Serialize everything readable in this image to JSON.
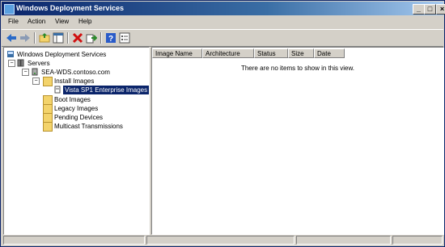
{
  "window": {
    "title": "Windows Deployment Services",
    "controls": {
      "minimize": "_",
      "maximize": "□",
      "close": "×"
    }
  },
  "menu": [
    "File",
    "Action",
    "View",
    "Help"
  ],
  "toolbar": {
    "icons": [
      "back-arrow-icon",
      "forward-arrow-icon",
      "up-folder-icon",
      "show-hide-tree-icon",
      "delete-icon",
      "export-icon",
      "help-icon",
      "properties-icon"
    ]
  },
  "tree": {
    "root": "Windows Deployment Services",
    "servers": "Servers",
    "server": "SEA-WDS.contoso.com",
    "install_images": "Install Images",
    "image_group": "Vista SP1 Enterprise Images",
    "boot_images": "Boot Images",
    "legacy_images": "Legacy Images",
    "pending_devices": "Pending Devices",
    "multicast": "Multicast Transmissions",
    "expander_minus": "−"
  },
  "list": {
    "columns": [
      "Image Name",
      "Architecture",
      "Status",
      "Size",
      "Date"
    ],
    "empty_message": "There are no items to show in this view."
  },
  "colors": {
    "title_active": "#0a246a",
    "selection": "#0a246a",
    "chrome": "#d4d0c8"
  }
}
